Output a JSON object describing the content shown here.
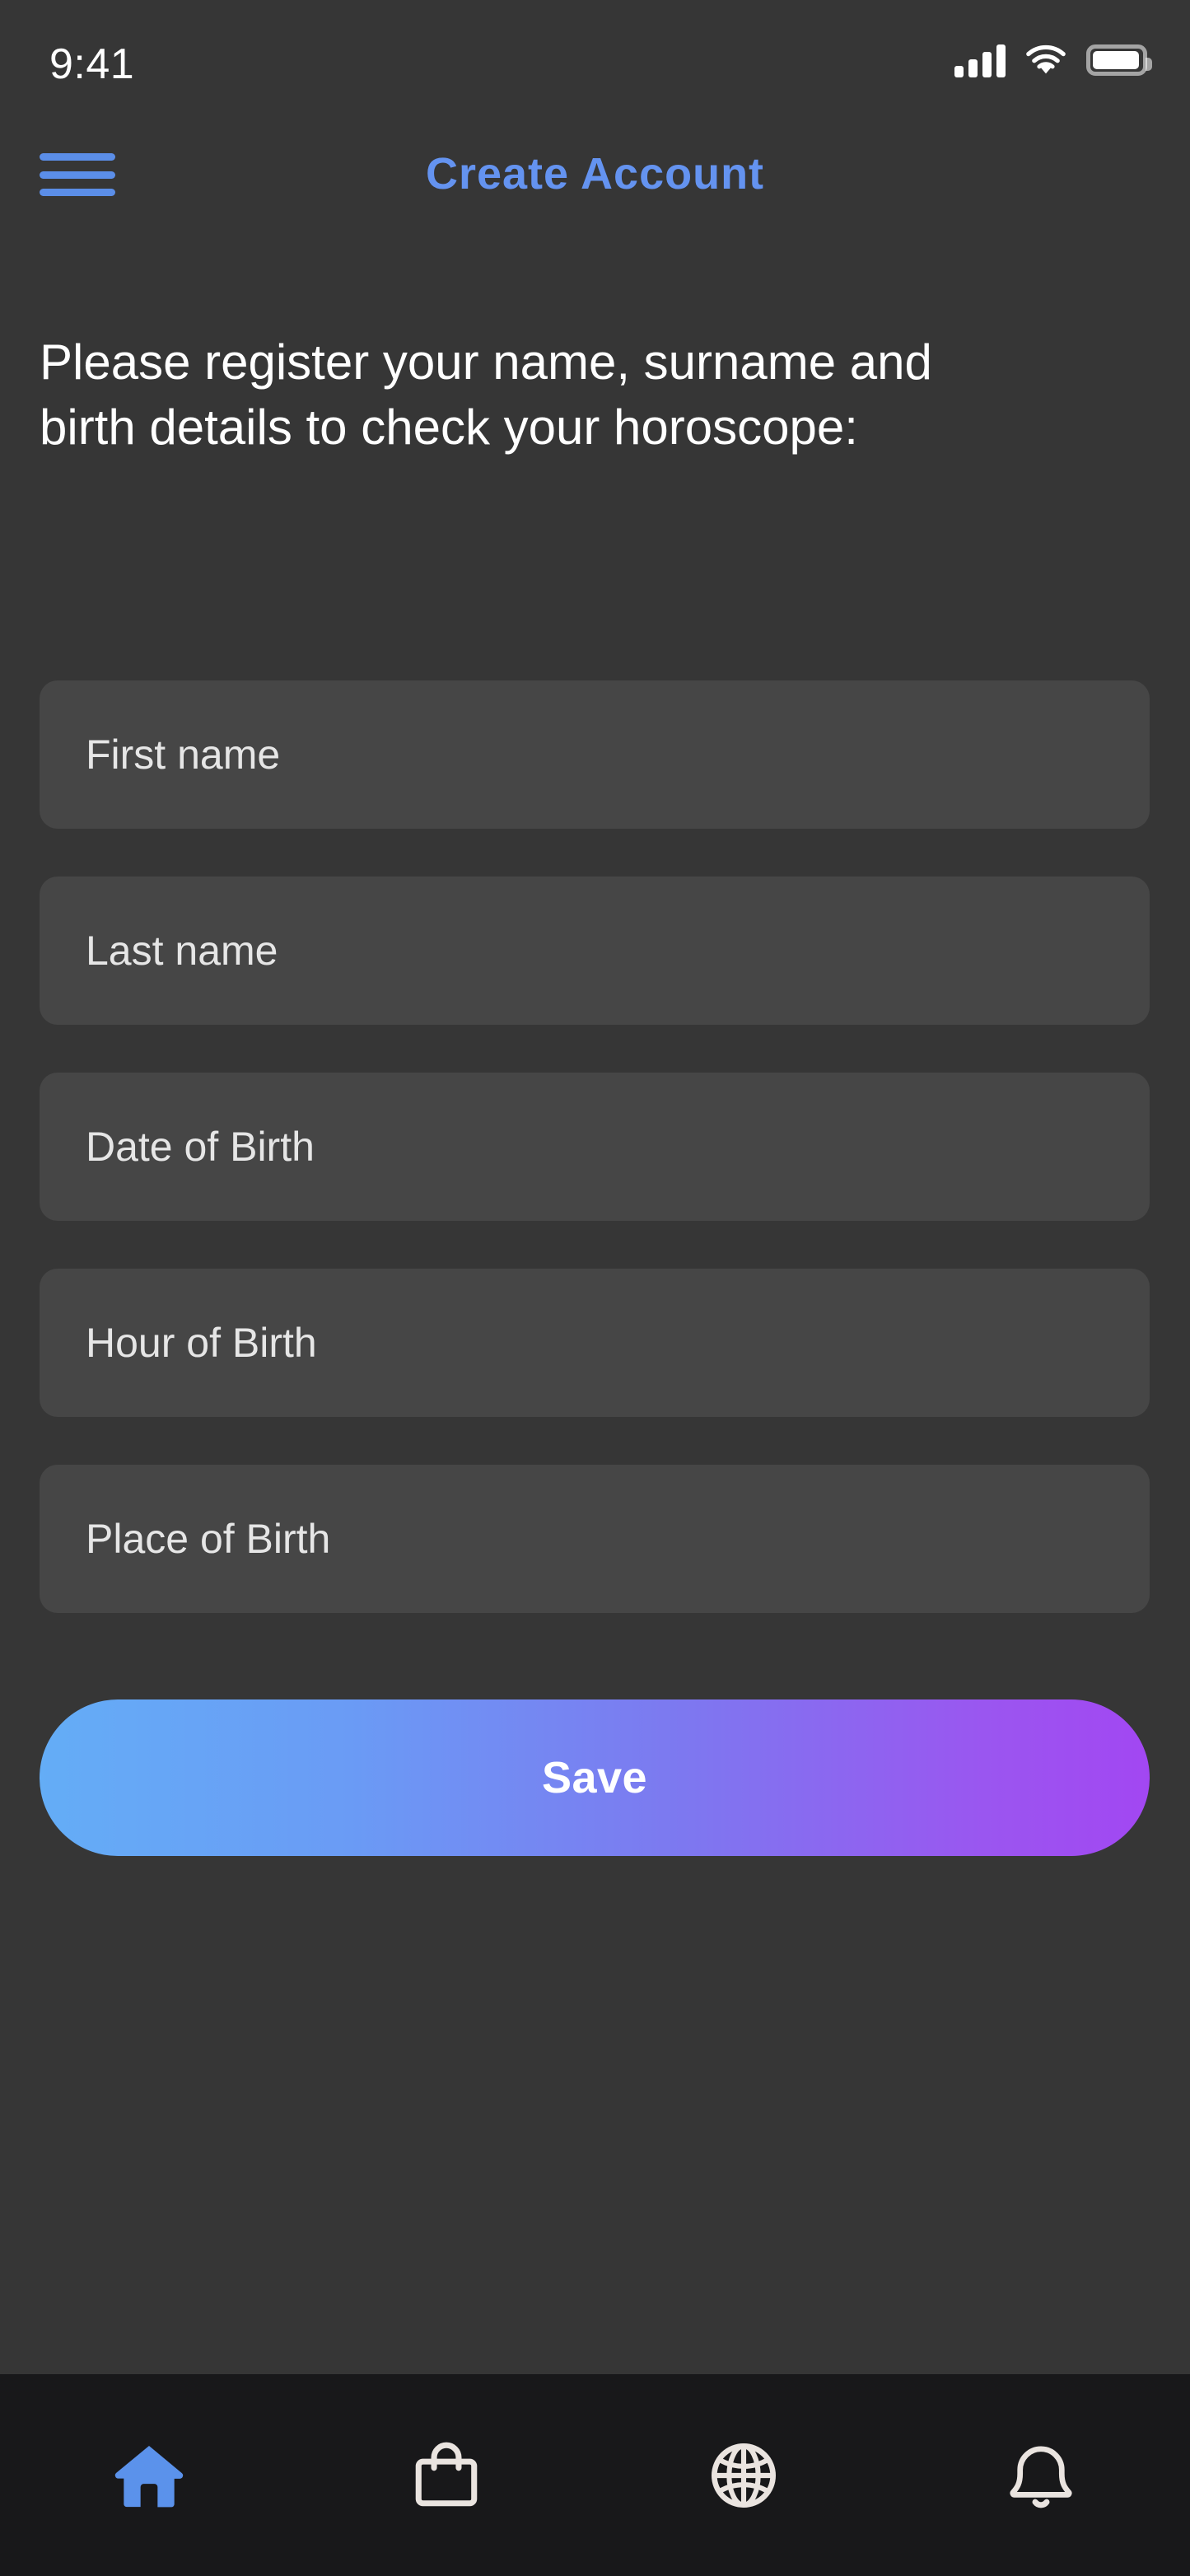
{
  "status_bar": {
    "time": "9:41",
    "cellular_icon": "cellular-signal-icon",
    "wifi_icon": "wifi-icon",
    "battery_icon": "battery-full-icon"
  },
  "header": {
    "menu_icon": "hamburger-menu-icon",
    "title": "Create Account",
    "title_color": "#6493F0"
  },
  "main": {
    "intro_text": "Please register your name, surname and birth details to check your horoscope:",
    "fields": [
      {
        "label": "First name",
        "value": "",
        "placeholder": "First name"
      },
      {
        "label": "Last name",
        "value": "",
        "placeholder": "Last name"
      },
      {
        "label": "Date of Birth",
        "value": "",
        "placeholder": "Date of Birth"
      },
      {
        "label": "Hour of Birth",
        "value": "",
        "placeholder": "Hour of Birth"
      },
      {
        "label": "Place of Birth",
        "value": "",
        "placeholder": "Place of Birth"
      }
    ],
    "save_button": {
      "label": "Save",
      "gradient_start": "#64ADF6",
      "gradient_end": "#A247F2"
    }
  },
  "bottom_nav": {
    "background_color": "#18181A",
    "active_color": "#5B92EB",
    "inactive_color": "#EAE4E0",
    "items": [
      {
        "icon": "home-icon",
        "name": "home",
        "active": true
      },
      {
        "icon": "shopping-bag-icon",
        "name": "shop",
        "active": false
      },
      {
        "icon": "globe-icon",
        "name": "explore",
        "active": false
      },
      {
        "icon": "bell-icon",
        "name": "notifications",
        "active": false
      }
    ]
  },
  "theme": {
    "page_background": "#363636",
    "field_background": "#464646",
    "text_primary": "#FFFFFF",
    "accent": "#6493F0"
  }
}
